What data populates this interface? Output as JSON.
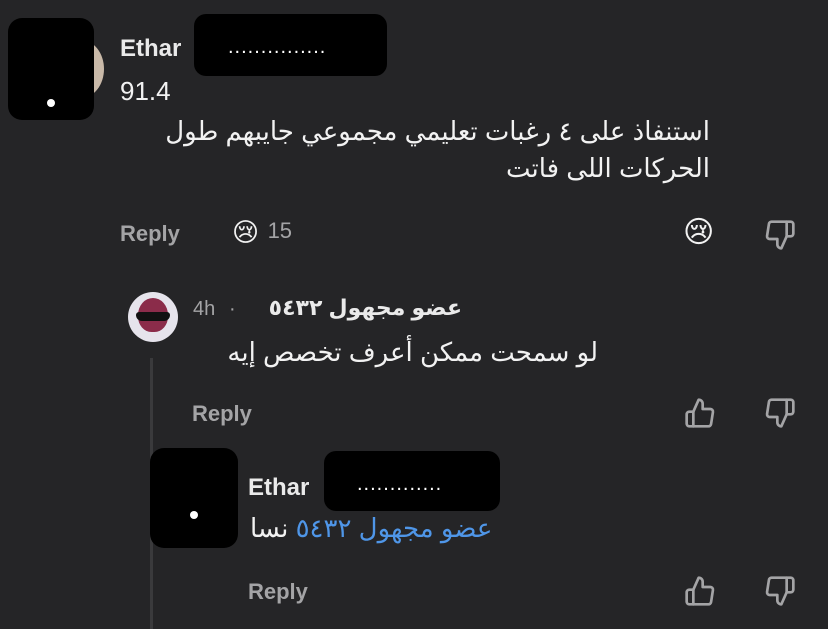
{
  "comment": {
    "author": "Ethar",
    "redacted_label": "...............",
    "score": "91.4",
    "text_line1": "استنفاذ على ٤ رغبات تعليمي مجموعي جايبهم طول",
    "text_line2": "الحركات اللى فاتت",
    "reply_label": "Reply",
    "reaction_count": "15",
    "reaction_emoji": "😢"
  },
  "reply1": {
    "author": "عضو مجهول ٥٤٣٢",
    "separator": "·",
    "time": "4h",
    "text": "لو سمحت ممكن أعرف تخصص إيه",
    "reply_label": "Reply"
  },
  "reply2": {
    "author": "Ethar",
    "redacted_label": ".............",
    "mention": "عضو مجهول ٥٤٣٢",
    "text": "نسا",
    "reply_label": "Reply"
  },
  "colors": {
    "background": "#252527",
    "muted_text": "#a4a4a6",
    "mention": "#4f96e8"
  }
}
